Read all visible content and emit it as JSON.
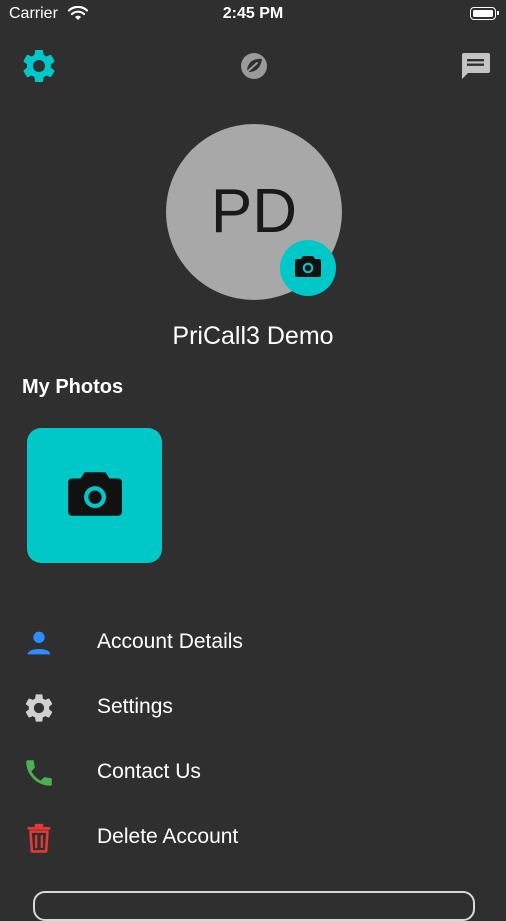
{
  "status_bar": {
    "carrier": "Carrier",
    "time": "2:45 PM"
  },
  "top_bar": {
    "left_icon": "gear-icon",
    "center_icon": "leaf-badge-icon",
    "right_icon": "chat-icon"
  },
  "profile": {
    "initials": "PD",
    "name": "PriCall3 Demo"
  },
  "photos": {
    "title": "My Photos"
  },
  "menu": [
    {
      "label": "Account Details",
      "icon": "person-icon",
      "color": "#2f8cff"
    },
    {
      "label": "Settings",
      "icon": "gear-icon",
      "color": "#d0d0d0"
    },
    {
      "label": "Contact Us",
      "icon": "phone-icon",
      "color": "#4caf50"
    },
    {
      "label": "Delete Account",
      "icon": "trash-icon",
      "color": "#e53935"
    }
  ],
  "colors": {
    "accent": "#00c8c8",
    "background": "#2f2f2f"
  }
}
